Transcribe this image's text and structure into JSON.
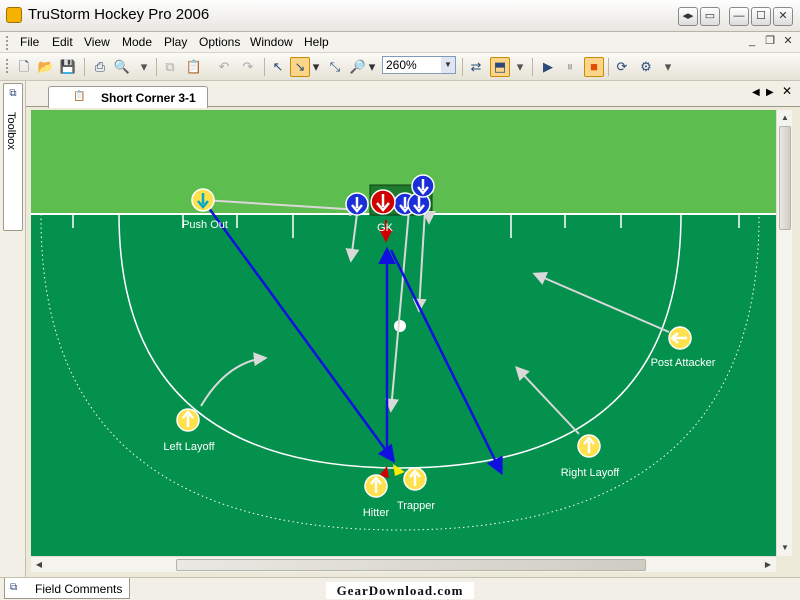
{
  "window": {
    "title": "TruStorm Hockey Pro 2006"
  },
  "menu": {
    "items": [
      "File",
      "Edit",
      "View",
      "Mode",
      "Play",
      "Options",
      "Window",
      "Help"
    ]
  },
  "toolbar": {
    "zoom_value": "260%"
  },
  "toolbox": {
    "label": "Toolbox"
  },
  "document_tab": {
    "label": "Short Corner 3-1"
  },
  "field": {
    "players": [
      {
        "label": "Push Out",
        "team": "attack",
        "direction": "down",
        "color": "#ffe14d",
        "arrow_color": "#00a9c8"
      },
      {
        "label": "GK",
        "team": "goalkeeper",
        "direction": "down",
        "color": "#d00000"
      },
      {
        "label": "Post Attacker",
        "team": "attack",
        "direction": "left",
        "color": "#ffe14d"
      },
      {
        "label": "Left Layoff",
        "team": "attack",
        "direction": "up",
        "color": "#ffe14d"
      },
      {
        "label": "Right Layoff",
        "team": "attack",
        "direction": "up",
        "color": "#ffe14d"
      },
      {
        "label": "Hitter",
        "team": "attack",
        "direction": "up",
        "color": "#ffe14d"
      },
      {
        "label": "Trapper",
        "team": "attack",
        "direction": "up",
        "color": "#ffe14d"
      }
    ],
    "defenders_count": 5,
    "colors": {
      "pitch": "#04904d",
      "outside": "#5dbd4e",
      "pass_line": "#1010e0",
      "defender": "#1a2fd8"
    }
  },
  "bottom": {
    "field_comments_label": "Field Comments"
  },
  "watermark": {
    "text": "GearDownload.com"
  }
}
